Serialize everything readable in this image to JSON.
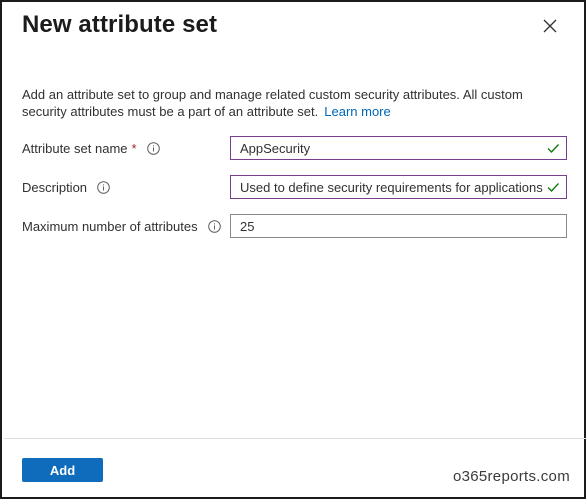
{
  "panel": {
    "title": "New attribute set",
    "description": "Add an attribute set to group and manage related custom security attributes. All custom security attributes must be a part of an attribute set.",
    "learn_more": "Learn more"
  },
  "form": {
    "name_label": "Attribute set name",
    "required_mark": "*",
    "name_value": "AppSecurity",
    "description_label": "Description",
    "description_value": "Used to define security requirements for applications",
    "max_label": "Maximum number of attributes",
    "max_value": "25"
  },
  "footer": {
    "add_label": "Add"
  },
  "watermark": "o365reports.com",
  "colors": {
    "accent": "#0f6cbd",
    "link": "#0067b8",
    "valid_border": "#7a3e8f",
    "check": "#107c10",
    "required": "#a4262c"
  },
  "icons": {
    "close": "close-icon",
    "info": "info-icon",
    "valid": "checkmark-icon"
  }
}
